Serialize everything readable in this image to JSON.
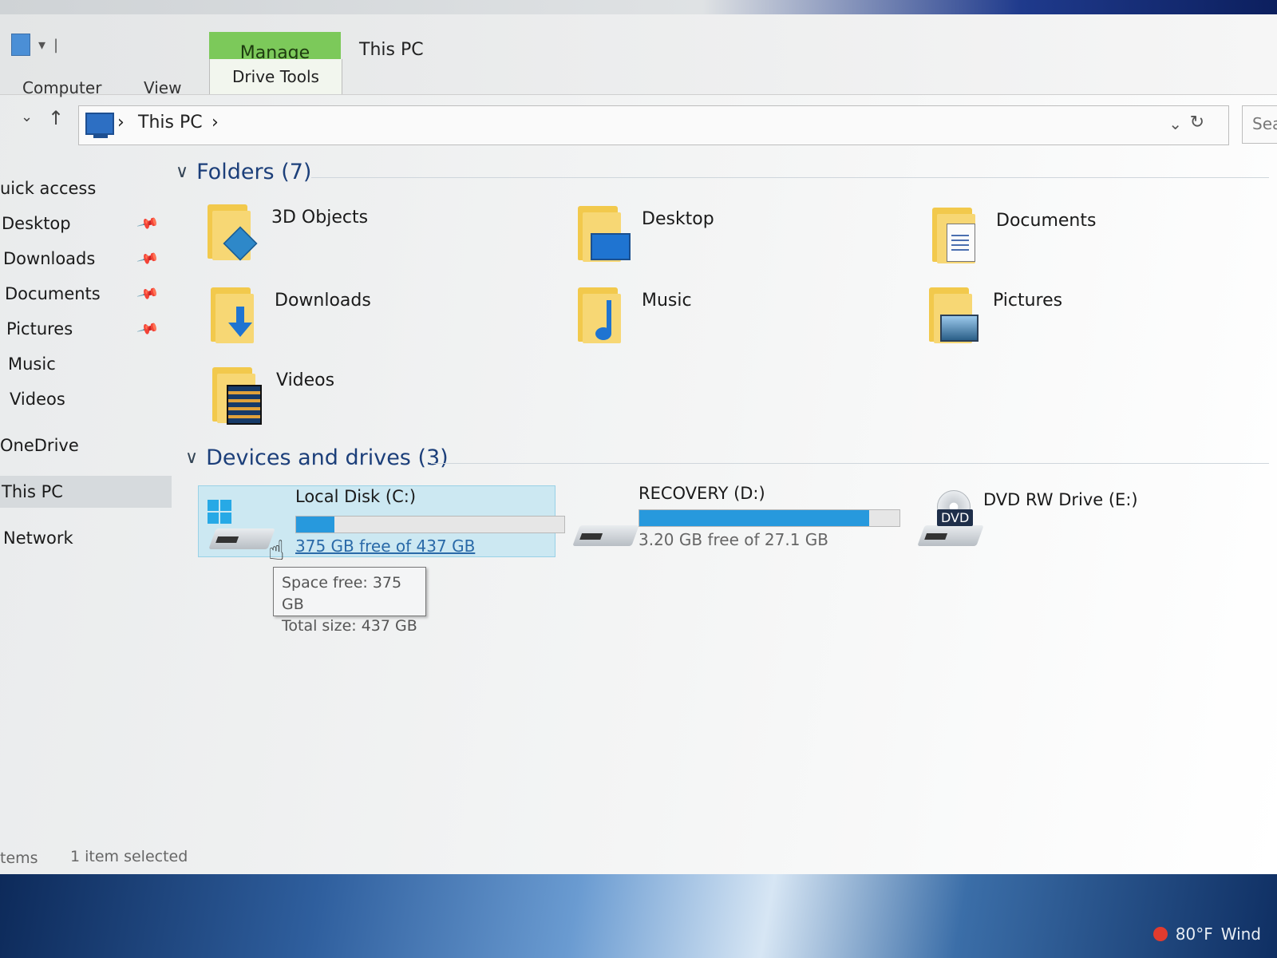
{
  "ribbon": {
    "context_tab": "Manage",
    "window_title": "This PC",
    "context_subtab": "Drive Tools",
    "tabs": [
      "Computer",
      "View"
    ]
  },
  "address": {
    "crumb": "This PC",
    "separator": "›",
    "search_partial": "Sea"
  },
  "sidebar": {
    "items": [
      {
        "label": "uick access",
        "pinned": false
      },
      {
        "label": "Desktop",
        "pinned": true
      },
      {
        "label": "Downloads",
        "pinned": true
      },
      {
        "label": "Documents",
        "pinned": true
      },
      {
        "label": "Pictures",
        "pinned": true
      },
      {
        "label": "Music",
        "pinned": false
      },
      {
        "label": "Videos",
        "pinned": false
      },
      {
        "label": "OneDrive",
        "pinned": false
      },
      {
        "label": "This PC",
        "pinned": false,
        "selected": true
      },
      {
        "label": "Network",
        "pinned": false
      }
    ]
  },
  "folders": {
    "header": "Folders (7)",
    "items": [
      {
        "name": "3D Objects",
        "icon": "3d-objects-folder-icon"
      },
      {
        "name": "Desktop",
        "icon": "desktop-folder-icon"
      },
      {
        "name": "Documents",
        "icon": "documents-folder-icon"
      },
      {
        "name": "Downloads",
        "icon": "downloads-folder-icon"
      },
      {
        "name": "Music",
        "icon": "music-folder-icon"
      },
      {
        "name": "Pictures",
        "icon": "pictures-folder-icon"
      },
      {
        "name": "Videos",
        "icon": "videos-folder-icon"
      }
    ]
  },
  "drives": {
    "header": "Devices and drives (3)",
    "items": [
      {
        "name": "Local Disk (C:)",
        "free_text": "375 GB free of 437 GB",
        "used_fraction": 0.142,
        "selected": true
      },
      {
        "name": "RECOVERY (D:)",
        "free_text": "3.20 GB free of 27.1 GB",
        "used_fraction": 0.882
      },
      {
        "name": "DVD RW Drive (E:)",
        "badge": "DVD"
      }
    ]
  },
  "tooltip": {
    "line1": "Space free: 375 GB",
    "line2": "Total size: 437 GB"
  },
  "status": {
    "items_partial": "tems",
    "selected": "1 item selected"
  },
  "taskbar": {
    "weather": "80°F",
    "partial": "Wind"
  },
  "colors": {
    "manage_tab": "#7cc95a",
    "progress": "#2799dd",
    "selection": "#cce8f2",
    "group_header": "#1c3f7a"
  }
}
